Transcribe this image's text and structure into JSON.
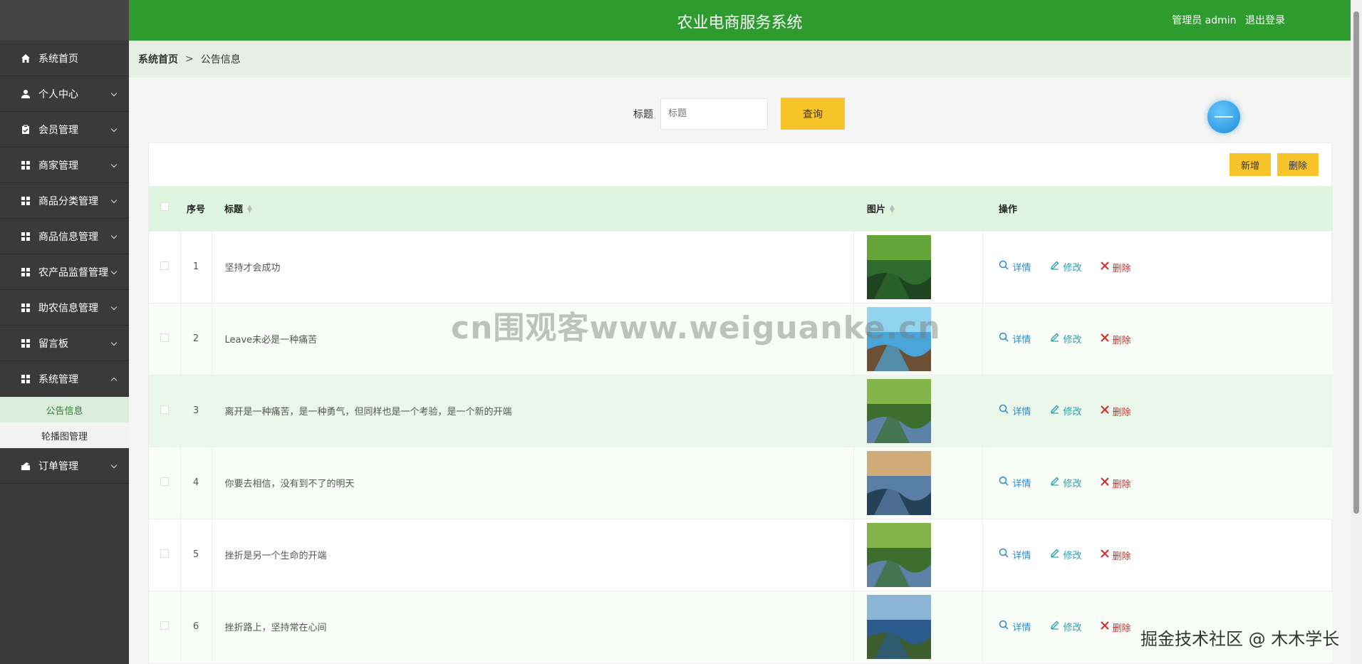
{
  "sidebar": {
    "items": [
      {
        "label": "系统首页",
        "icon": "home-icon"
      },
      {
        "label": "个人中心",
        "icon": "user-icon"
      },
      {
        "label": "会员管理",
        "icon": "clipboard-icon"
      },
      {
        "label": "商家管理",
        "icon": "grid-icon"
      },
      {
        "label": "商品分类管理",
        "icon": "grid-icon"
      },
      {
        "label": "商品信息管理",
        "icon": "grid-icon"
      },
      {
        "label": "农产品监督管理",
        "icon": "grid-icon"
      },
      {
        "label": "助农信息管理",
        "icon": "grid-icon"
      },
      {
        "label": "留言板",
        "icon": "grid-icon"
      },
      {
        "label": "系统管理",
        "icon": "grid-icon"
      }
    ],
    "sub_items": [
      {
        "label": "公告信息"
      },
      {
        "label": "轮播图管理"
      }
    ],
    "last_item": {
      "label": "订单管理",
      "icon": "box-icon"
    }
  },
  "header": {
    "title": "农业电商服务系统",
    "user_label": "管理员 admin",
    "logout": "退出登录"
  },
  "breadcrumb": {
    "home": "系统首页",
    "sep": ">",
    "current": "公告信息"
  },
  "search": {
    "label": "标题",
    "placeholder": "标题",
    "query_btn": "查询"
  },
  "actions": {
    "add": "新增",
    "delete": "删除"
  },
  "table": {
    "headers": {
      "no": "序号",
      "title": "标题",
      "image": "图片",
      "op": "操作"
    },
    "op_labels": {
      "detail": "详情",
      "edit": "修改",
      "delete": "删除"
    },
    "rows": [
      {
        "no": "1",
        "title": "坚持才会成功",
        "img_colors": [
          "#2f6b2c",
          "#6fae3c",
          "#1e4420"
        ]
      },
      {
        "no": "2",
        "title": "Leave未必是一种痛苦",
        "img_colors": [
          "#4aa6d8",
          "#9fdcf2",
          "#6b5035"
        ]
      },
      {
        "no": "3",
        "title": "离开是一种痛苦，是一种勇气，但同样也是一个考验，是一个新的开端",
        "img_colors": [
          "#3c6e2e",
          "#8fc250",
          "#5d82a8"
        ]
      },
      {
        "no": "4",
        "title": "你要去相信，没有到不了的明天",
        "img_colors": [
          "#5a7fa6",
          "#e3b36e",
          "#254158"
        ]
      },
      {
        "no": "5",
        "title": "挫折是另一个生命的开端",
        "img_colors": [
          "#3c6e2e",
          "#8fc250",
          "#5d82a8"
        ]
      },
      {
        "no": "6",
        "title": "挫折路上，坚持常在心间",
        "img_colors": [
          "#2b5b8c",
          "#9ec4e0",
          "#3d5d2e"
        ]
      }
    ]
  },
  "watermark": "cn围观客www.weiguanke.cn",
  "watermark2": "掘金技术社区 @ 木木学长"
}
